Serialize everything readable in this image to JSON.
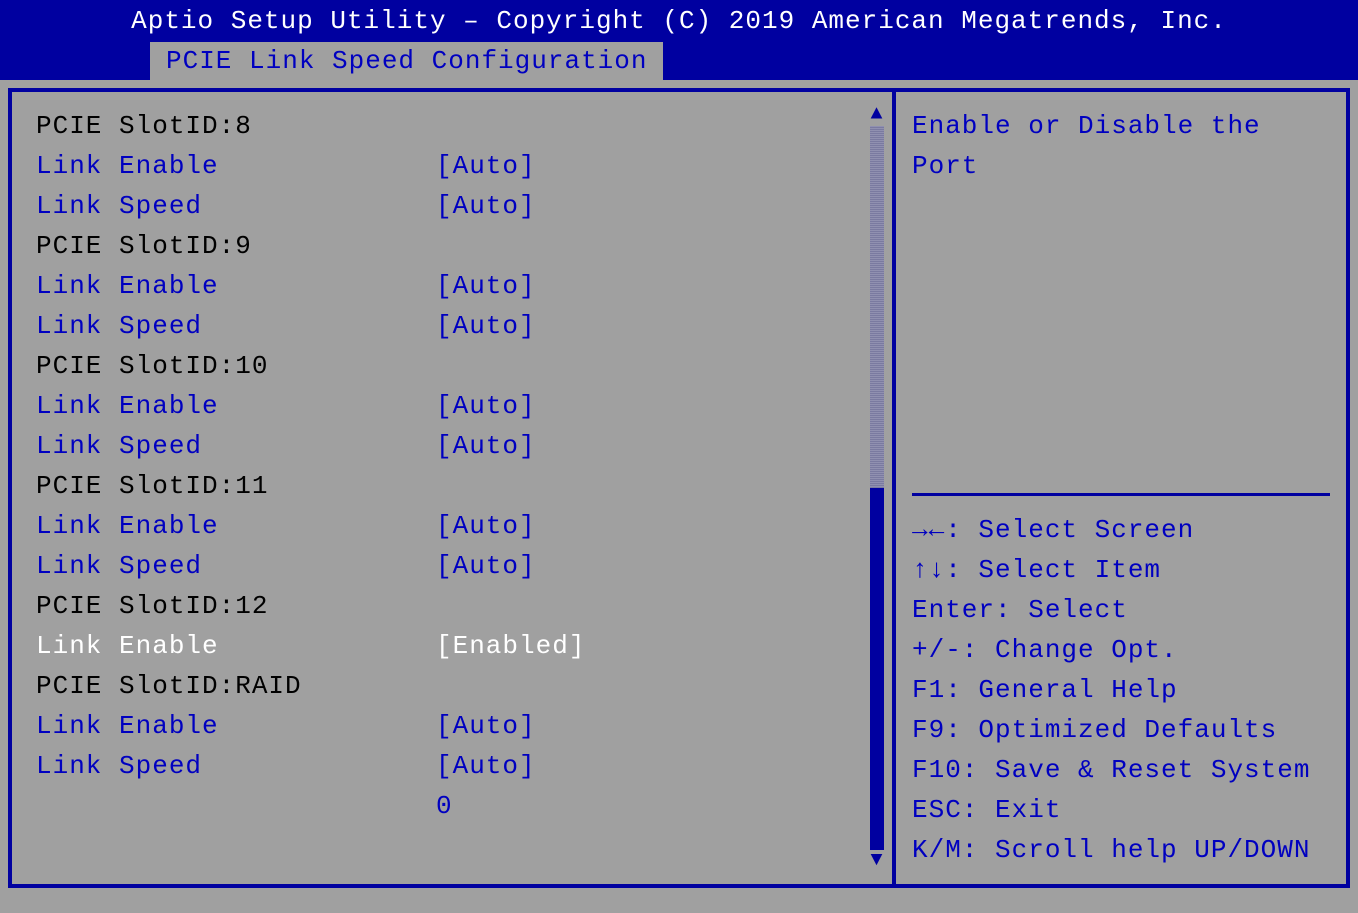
{
  "header": {
    "title": "Aptio Setup Utility – Copyright (C) 2019 American Megatrends, Inc.",
    "tab": "PCIE Link Speed Configuration"
  },
  "left": {
    "rows": [
      {
        "type": "header",
        "label": "PCIE SlotID:8"
      },
      {
        "type": "option",
        "label": "Link Enable",
        "value": "[Auto]"
      },
      {
        "type": "option",
        "label": "Link Speed",
        "value": "[Auto]"
      },
      {
        "type": "header",
        "label": "PCIE SlotID:9"
      },
      {
        "type": "option",
        "label": "Link Enable",
        "value": "[Auto]"
      },
      {
        "type": "option",
        "label": "Link Speed",
        "value": "[Auto]"
      },
      {
        "type": "header",
        "label": "PCIE SlotID:10"
      },
      {
        "type": "option",
        "label": "Link Enable",
        "value": "[Auto]"
      },
      {
        "type": "option",
        "label": "Link Speed",
        "value": "[Auto]"
      },
      {
        "type": "header",
        "label": "PCIE SlotID:11"
      },
      {
        "type": "option",
        "label": "Link Enable",
        "value": "[Auto]"
      },
      {
        "type": "option",
        "label": "Link Speed",
        "value": "[Auto]"
      },
      {
        "type": "header",
        "label": "PCIE SlotID:12"
      },
      {
        "type": "selected",
        "label": "Link Enable",
        "value": "[Enabled]"
      },
      {
        "type": "header",
        "label": "PCIE SlotID:RAID"
      },
      {
        "type": "option",
        "label": "Link Enable",
        "value": "[Auto]"
      },
      {
        "type": "option",
        "label": "Link Speed",
        "value": "[Auto]"
      }
    ],
    "trailing_value": "0"
  },
  "help": {
    "line1": "Enable or Disable the",
    "line2": "Port"
  },
  "nav": {
    "l1": "→←: Select Screen",
    "l2": "↑↓: Select Item",
    "l3": "Enter: Select",
    "l4": "+/-: Change Opt.",
    "l5": "F1: General Help",
    "l6": "F9: Optimized Defaults",
    "l7": "F10: Save & Reset System",
    "l8": "ESC: Exit",
    "l9": "K/M: Scroll help UP/DOWN"
  }
}
